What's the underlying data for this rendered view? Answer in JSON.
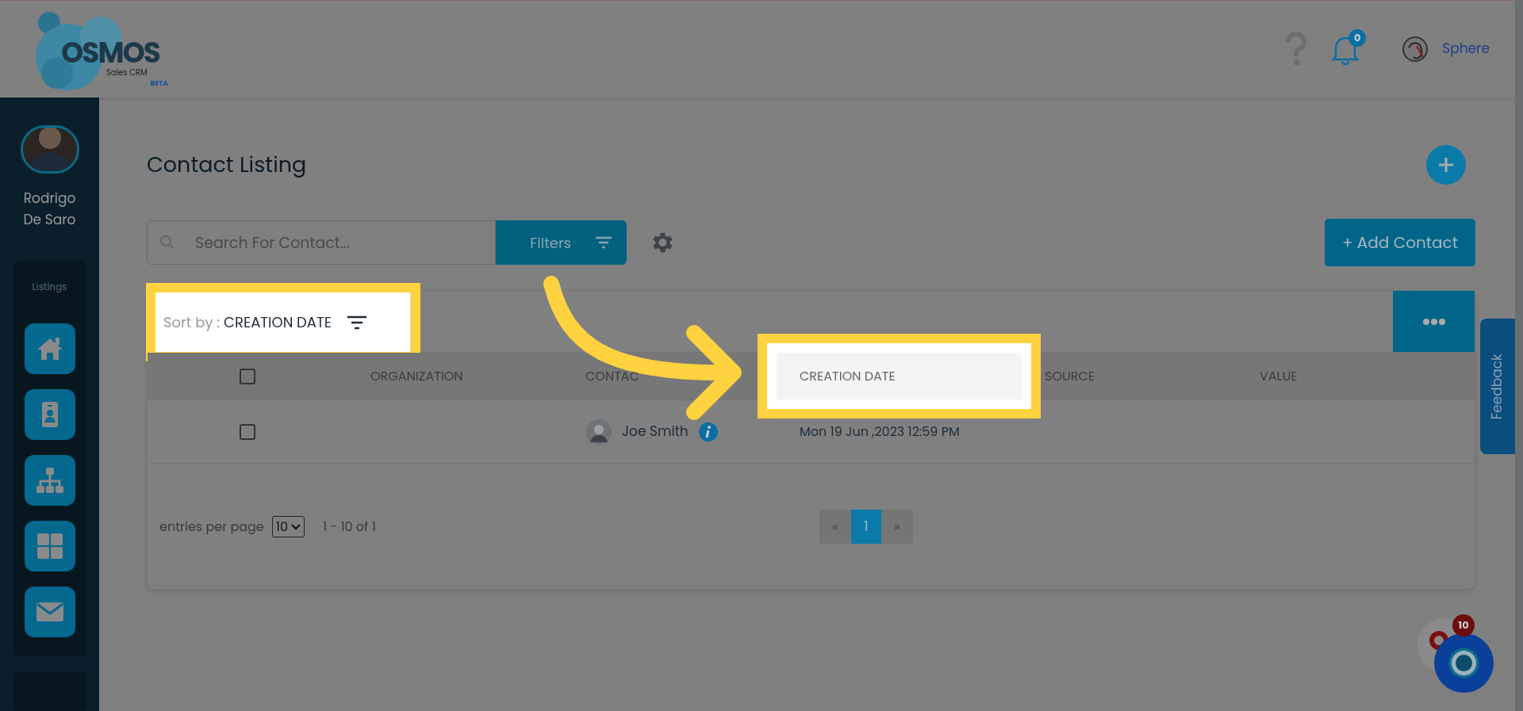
{
  "header": {
    "logo": {
      "wordmark": "OSMOS",
      "subtitle": "Sales CRM",
      "tag": "BETA"
    },
    "notification_count": "0",
    "user_name": "Sphere"
  },
  "sidebar": {
    "user_name": "Rodrigo De Saro",
    "section": "Listings"
  },
  "page": {
    "title": "Contact Listing",
    "search": {
      "placeholder": "Search For Contact..."
    },
    "filters_button": "Filters",
    "add_contact_button": "+ Add Contact"
  },
  "sort": {
    "label": "Sort by :",
    "value": "CREATION DATE",
    "highlighted": true
  },
  "table": {
    "header_checked": false,
    "columns": [
      {
        "label": "ORGANIZATION",
        "highlighted": false
      },
      {
        "label": "CONTAC",
        "highlighted": false
      },
      {
        "label": "CREATION DATE",
        "highlighted": true
      },
      {
        "label": "SOURCE",
        "highlighted": false
      },
      {
        "label": "VALUE",
        "highlighted": false
      }
    ],
    "rows": [
      {
        "checked": false,
        "contact": "Joe Smith",
        "creation_date": "Mon 19 Jun ,2023 12:59 PM"
      }
    ]
  },
  "pagination": {
    "entries_label": "entries per page",
    "page_size": "10",
    "range": "1 - 10 of 1",
    "prev": "«",
    "next": "»",
    "pages": [
      {
        "label": "1",
        "selected": true
      }
    ]
  },
  "feedback": "Feedback",
  "chat_badge": "10"
}
